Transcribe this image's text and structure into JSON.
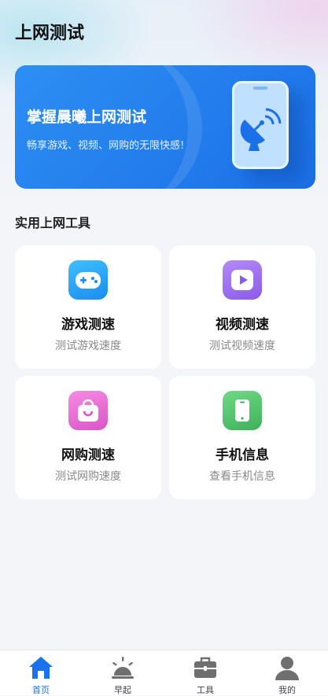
{
  "header": {
    "title": "上网测试"
  },
  "banner": {
    "title": "掌握晨曦上网测试",
    "subtitle": "畅享游戏、视频、网购的无限快感!",
    "icon": "phone-satellite-icon"
  },
  "tools": {
    "section_title": "实用上网工具",
    "items": [
      {
        "name": "游戏测速",
        "desc": "测试游戏速度",
        "icon": "gamepad-icon",
        "color": "#1ea0f5"
      },
      {
        "name": "视频测速",
        "desc": "测试视频速度",
        "icon": "video-play-icon",
        "color": "#9b6cf0"
      },
      {
        "name": "网购测速",
        "desc": "测试网购速度",
        "icon": "shopping-bag-icon",
        "color": "#e866d4"
      },
      {
        "name": "手机信息",
        "desc": "查看手机信息",
        "icon": "phone-icon",
        "color": "#4fc36a"
      }
    ]
  },
  "tabbar": {
    "active_color": "#1a73ee",
    "items": [
      {
        "label": "首页",
        "icon": "home-icon",
        "active": true
      },
      {
        "label": "早起",
        "icon": "sunrise-icon",
        "active": false
      },
      {
        "label": "工具",
        "icon": "toolbox-icon",
        "active": false
      },
      {
        "label": "我的",
        "icon": "user-icon",
        "active": false
      }
    ]
  }
}
